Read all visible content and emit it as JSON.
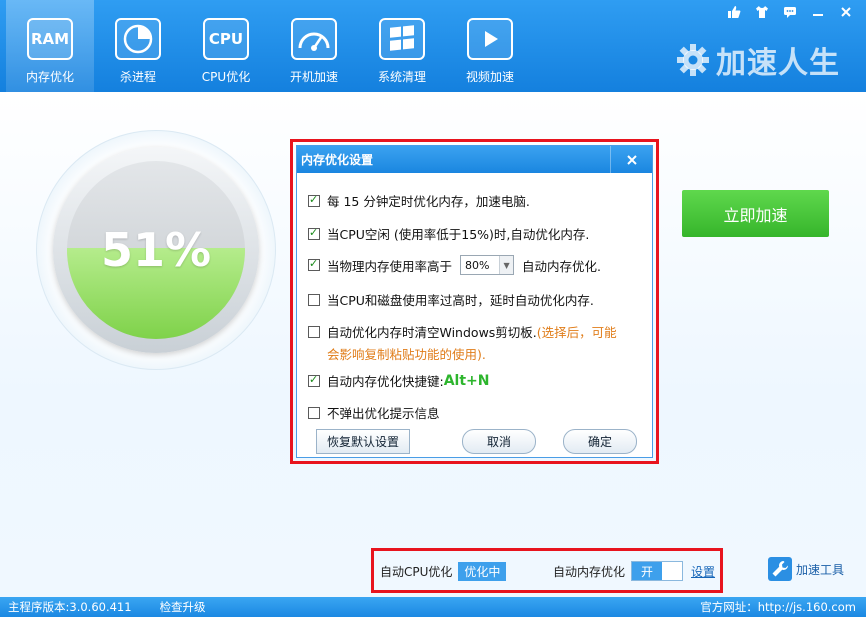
{
  "nav": {
    "items": [
      {
        "label": "内存优化",
        "icon_text": "RAM",
        "icon": "ram-icon"
      },
      {
        "label": "杀进程",
        "icon_text": "",
        "icon": "pie-chart-icon"
      },
      {
        "label": "CPU优化",
        "icon_text": "CPU",
        "icon": "cpu-icon"
      },
      {
        "label": "开机加速",
        "icon_text": "",
        "icon": "gauge-icon"
      },
      {
        "label": "系统清理",
        "icon_text": "",
        "icon": "windows-icon"
      },
      {
        "label": "视频加速",
        "icon_text": "",
        "icon": "play-icon"
      }
    ],
    "active_index": 0
  },
  "brand": {
    "name": "加速人生"
  },
  "gauge": {
    "percent_text": "51%",
    "percent": 51
  },
  "speed_button": {
    "label": "立即加速"
  },
  "dialog": {
    "title": "内存优化设置",
    "options": [
      {
        "label": "每 15 分钟定时优化内存，加速电脑.",
        "checked": true
      },
      {
        "label": "当CPU空闲 (使用率低于15%)时,自动优化内存.",
        "checked": true
      },
      {
        "label_before": "当物理内存使用率高于",
        "select_value": "80%",
        "label_after": "自动内存优化.",
        "checked": true
      },
      {
        "label": "当CPU和磁盘使用率过高时，延时自动优化内存.",
        "checked": false
      },
      {
        "label": "自动优化内存时清空Windows剪切板.",
        "note_line1": "(选择后，可能",
        "note_line2": "会影响复制粘贴功能的使用).",
        "checked": false
      },
      {
        "label": "自动内存优化快捷键:",
        "accent": "Alt+N",
        "checked": true
      },
      {
        "label": "不弹出优化提示信息",
        "checked": false
      }
    ],
    "buttons": {
      "reset": "恢复默认设置",
      "cancel": "取消",
      "ok": "确定"
    }
  },
  "bottom": {
    "cpu_label": "自动CPU优化",
    "cpu_status": "优化中",
    "mem_label": "自动内存优化",
    "toggle_on": "开",
    "settings_link": "设置",
    "tools_label": "加速工具"
  },
  "status": {
    "version": "主程序版本:3.0.60.411",
    "check_update": "检查升级",
    "website": "官方网址：http://js.160.com"
  },
  "colors": {
    "accent": "#1a86e0",
    "highlight": "#e8141e",
    "green": "#36b52b",
    "note": "#e07d1a"
  }
}
